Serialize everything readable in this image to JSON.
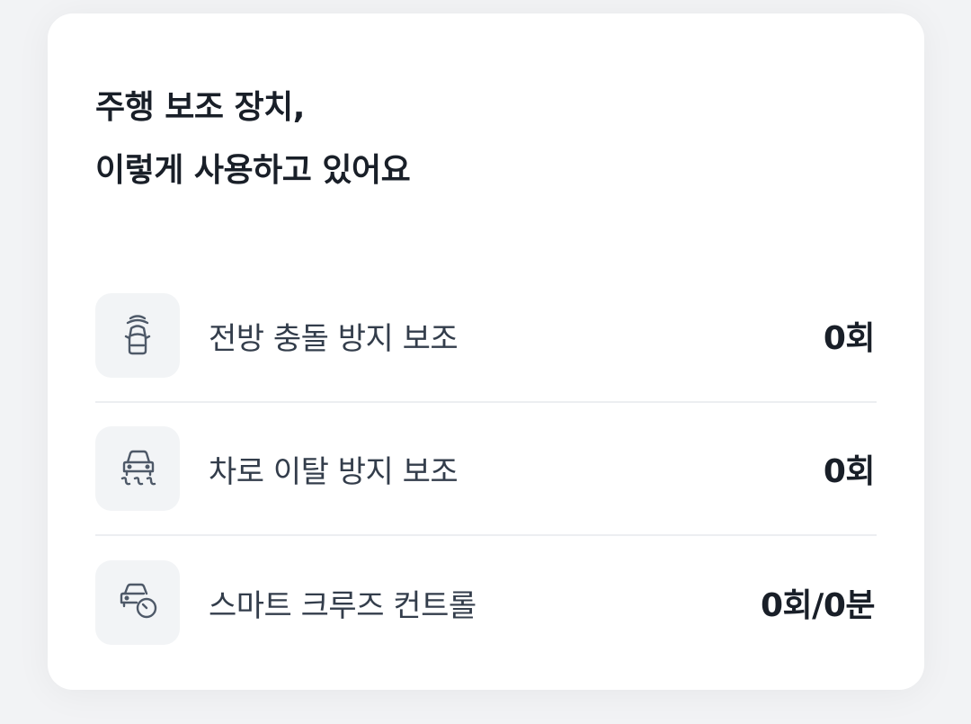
{
  "card": {
    "title_line1": "주행 보조 장치,",
    "title_line2": "이렇게 사용하고 있어요"
  },
  "items": [
    {
      "icon": "forward-collision-icon",
      "label": "전방 충돌 방지 보조",
      "value": "0회"
    },
    {
      "icon": "lane-departure-icon",
      "label": "차로 이탈 방지 보조",
      "value": "0회"
    },
    {
      "icon": "smart-cruise-icon",
      "label": "스마트 크루즈 컨트롤",
      "value": "0회/0분"
    }
  ],
  "colors": {
    "background": "#f2f3f5",
    "card": "#ffffff",
    "icon_bg": "#f2f4f6",
    "text_primary": "#191f28",
    "text_secondary": "#333d4b",
    "divider": "#eceef1"
  }
}
